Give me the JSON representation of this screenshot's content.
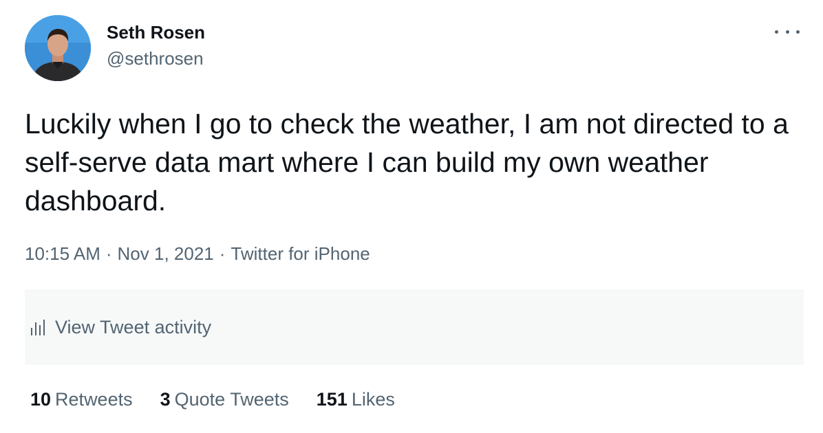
{
  "author": {
    "display_name": "Seth Rosen",
    "handle": "@sethrosen",
    "avatar_icon": "profile-photo"
  },
  "more_icon": "more-horizontal-icon",
  "tweet": {
    "text": "Luckily when I go to check the weather, I am not directed to a self-serve data mart where I can build my own weather dashboard.",
    "time": "10:15 AM",
    "date": "Nov 1, 2021",
    "source": "Twitter for iPhone",
    "separator": "·"
  },
  "activity": {
    "label": "View Tweet activity",
    "icon": "analytics-bars-icon"
  },
  "stats": {
    "retweets": {
      "count": "10",
      "label": "Retweets"
    },
    "quote_tweets": {
      "count": "3",
      "label": "Quote Tweets"
    },
    "likes": {
      "count": "151",
      "label": "Likes"
    }
  },
  "colors": {
    "text_primary": "#0f1419",
    "text_secondary": "#536471",
    "activity_bg": "#f7f9f9",
    "avatar_bg": "#3b8fd6"
  }
}
